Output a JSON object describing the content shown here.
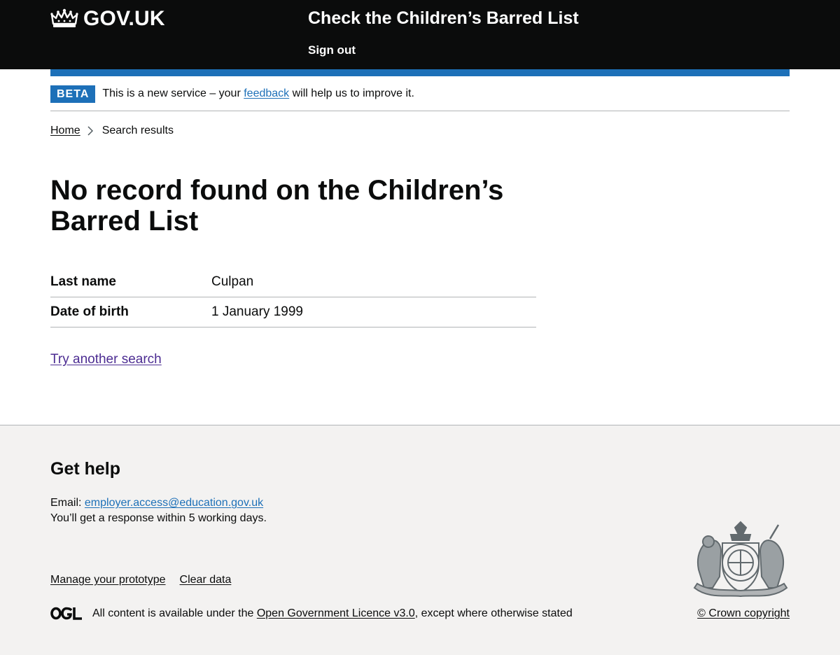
{
  "header": {
    "logo_text": "GOV.UK",
    "service_name": "Check the Children’s Barred List",
    "sign_out": "Sign out"
  },
  "phase_banner": {
    "tag": "BETA",
    "text_before": "This is a new service – your",
    "link": "feedback",
    "text_after": "will help us to improve it."
  },
  "breadcrumbs": {
    "home": "Home",
    "current": "Search results"
  },
  "main": {
    "heading": "No record found on the Children’s Barred List",
    "summary": [
      {
        "key": "Last name",
        "value": "Culpan"
      },
      {
        "key": "Date of birth",
        "value": "1 January 1999"
      }
    ],
    "try_again": "Try another search"
  },
  "footer": {
    "help_heading": "Get help",
    "email_label": "Email:",
    "email": "employer.access@education.gov.uk",
    "response_time": "You’ll get a response within 5 working days.",
    "links": [
      "Manage your prototype",
      "Clear data"
    ],
    "licence_before": "All content is available under the",
    "licence_link": "Open Government Licence v3.0",
    "licence_after": ", except where otherwise stated",
    "copyright": "© Crown copyright"
  },
  "colors": {
    "header_bg": "#0b0c0c",
    "brand_blue": "#1d70b8",
    "visited_link": "#4c2c92",
    "footer_bg": "#f3f2f1"
  }
}
